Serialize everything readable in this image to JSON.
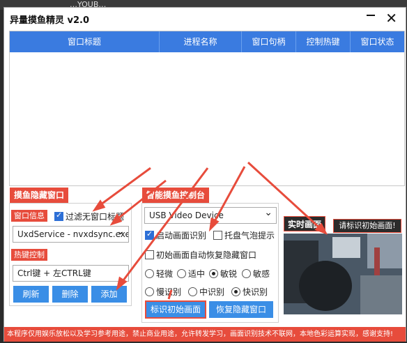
{
  "background": {
    "text": "…YOUB…"
  },
  "window": {
    "title": "异量摸鱼精灵 v2.0",
    "minimize": "—",
    "close": "✕"
  },
  "table": {
    "columns": [
      "窗口标题",
      "进程名称",
      "窗口句柄",
      "控制热键",
      "窗口状态"
    ]
  },
  "hide_panel": {
    "title": "摸鱼隐藏窗口",
    "window_info_label": "窗口信息",
    "filter_checkbox": "过滤无窗口标题",
    "process_value": "UxdService - nvxdsync.exe",
    "hotkey_label": "热键控制",
    "hotkey_value": "Ctrl键 + 左CTRL键",
    "refresh": "刷新",
    "delete": "删除",
    "add": "添加"
  },
  "control_panel": {
    "title": "智能摸鱼控制台",
    "camera_device": "USB Video Device",
    "enable_recognition": "启动画面识别",
    "tray_balloon": "托盘气泡提示",
    "auto_restore": "初始画面自动恢复隐藏窗口",
    "sensitivity": [
      "轻微",
      "适中",
      "敏锐",
      "敏感"
    ],
    "speed": [
      "慢识别",
      "中识别",
      "快识别"
    ],
    "mark_initial": "标识初始画面",
    "restore_hidden": "恢复隐藏窗口"
  },
  "realtime": {
    "label": "实时画面",
    "hint": "请标识初始画面!"
  },
  "footer": "本程序仅用娱乐放松以及学习参考用途，禁止商业用途，允许转发学习，画面识别技术不联网，本地色彩运算实现，感谢支持!",
  "colors": {
    "accent": "#e74c3c",
    "header": "#3a7be0",
    "button": "#3a8ee6"
  }
}
